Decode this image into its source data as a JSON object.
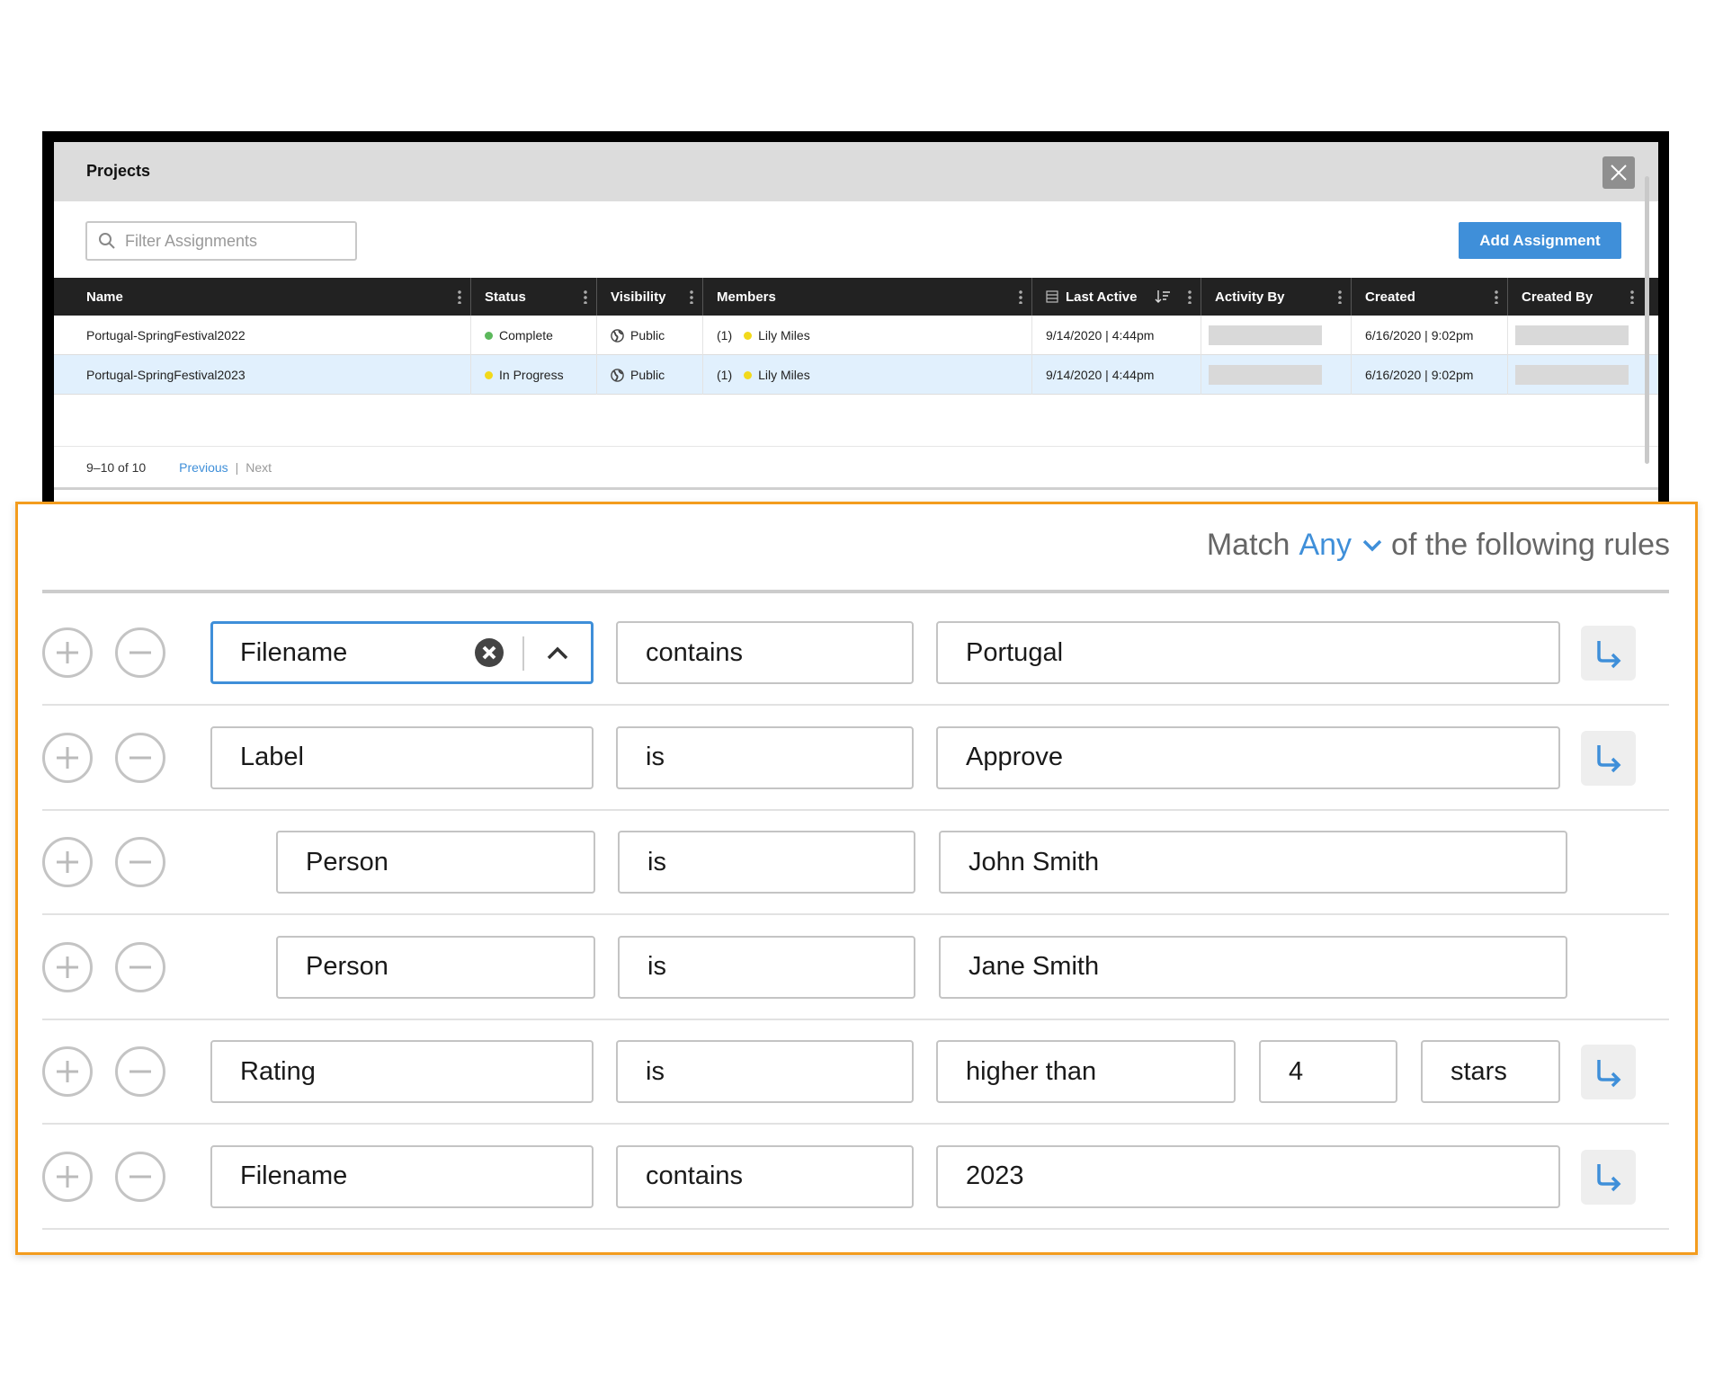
{
  "projects": {
    "title": "Projects",
    "filter_placeholder": "Filter Assignments",
    "add_button": "Add Assignment",
    "columns": [
      "Name",
      "Status",
      "Visibility",
      "Members",
      "Last Active",
      "Activity By",
      "Created",
      "Created By"
    ],
    "rows": [
      {
        "name": "Portugal-SpringFestival2022",
        "status": "Complete",
        "status_color": "#5cb85c",
        "visibility": "Public",
        "members_count": "(1)",
        "member": "Lily Miles",
        "last_active": "9/14/2020 | 4:44pm",
        "created": "6/16/2020 | 9:02pm",
        "selected": false
      },
      {
        "name": "Portugal-SpringFestival2023",
        "status": "In Progress",
        "status_color": "#f2d91a",
        "visibility": "Public",
        "members_count": "(1)",
        "member": "Lily Miles",
        "last_active": "9/14/2020 | 4:44pm",
        "created": "6/16/2020 | 9:02pm",
        "selected": true
      }
    ],
    "pagination": {
      "range": "9–10 of 10",
      "previous": "Previous",
      "separator": "|",
      "next": "Next"
    }
  },
  "rules": {
    "match_prefix": "Match",
    "match_value": "Any",
    "match_suffix": "of the following rules",
    "accent": "#3f8fd9",
    "highlight_border": "#f39c1e",
    "items": [
      {
        "field": "Filename",
        "operator": "contains",
        "value": "Portugal"
      },
      {
        "field": "Label",
        "operator": "is",
        "value": "Approve"
      },
      {
        "field": "Person",
        "operator": "is",
        "value": "John Smith"
      },
      {
        "field": "Person",
        "operator": "is",
        "value": "Jane Smith"
      },
      {
        "field": "Rating",
        "operator": "is",
        "value": "higher than",
        "number": "4",
        "unit": "stars"
      },
      {
        "field": "Filename",
        "operator": "contains",
        "value": "2023"
      }
    ]
  }
}
